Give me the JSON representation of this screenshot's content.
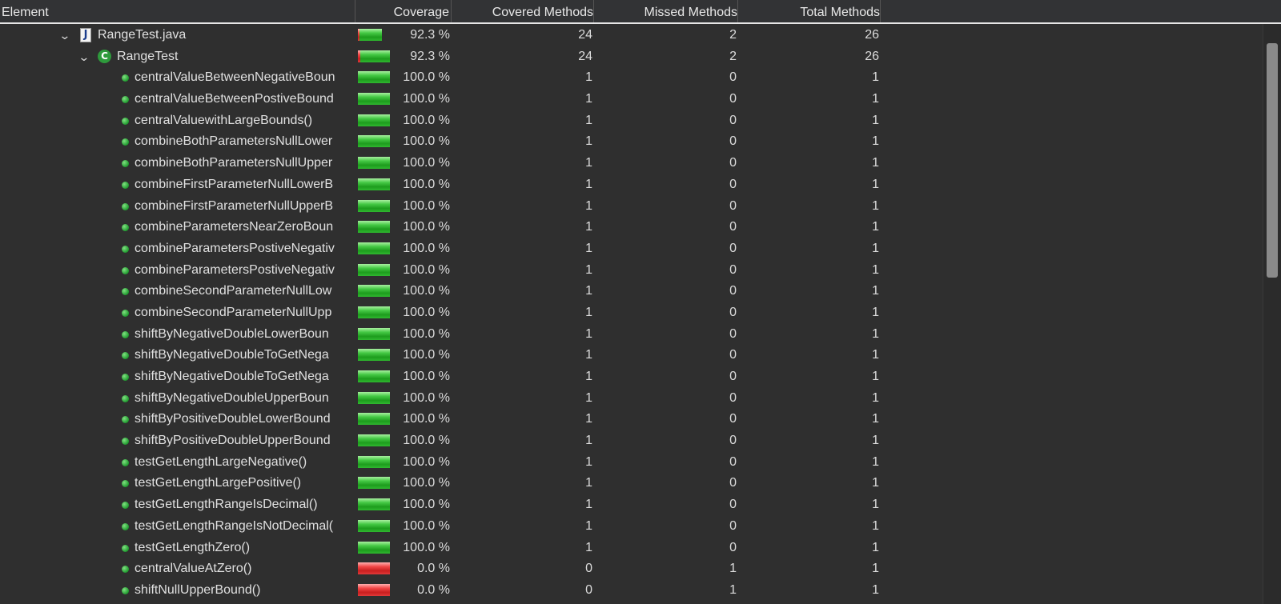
{
  "header": {
    "element": "Element",
    "coverage": "Coverage",
    "covered_methods": "Covered Methods",
    "missed_methods": "Missed Methods",
    "total_methods": "Total Methods"
  },
  "colors": {
    "background": "#2f2f2f",
    "covered": "#2fb82f",
    "missed": "#e03a3a",
    "text": "#e0e0e0"
  },
  "rows": [
    {
      "kind": "file",
      "name": "RangeTest.java",
      "icon": "java-file-icon",
      "coverage": "92.3 %",
      "ratio": 0.923,
      "covered": "24",
      "missed": "2",
      "total": "26"
    },
    {
      "kind": "class",
      "name": "RangeTest",
      "icon": "class-icon",
      "coverage": "92.3 %",
      "ratio": 0.923,
      "covered": "24",
      "missed": "2",
      "total": "26"
    },
    {
      "kind": "method",
      "name": "centralValueBetweenNegativeBoun",
      "icon": "method-icon",
      "coverage": "100.0 %",
      "ratio": 1.0,
      "covered": "1",
      "missed": "0",
      "total": "1"
    },
    {
      "kind": "method",
      "name": "centralValueBetweenPostiveBound",
      "icon": "method-icon",
      "coverage": "100.0 %",
      "ratio": 1.0,
      "covered": "1",
      "missed": "0",
      "total": "1"
    },
    {
      "kind": "method",
      "name": "centralValuewithLargeBounds()",
      "icon": "method-icon",
      "coverage": "100.0 %",
      "ratio": 1.0,
      "covered": "1",
      "missed": "0",
      "total": "1"
    },
    {
      "kind": "method",
      "name": "combineBothParametersNullLower",
      "icon": "method-icon",
      "coverage": "100.0 %",
      "ratio": 1.0,
      "covered": "1",
      "missed": "0",
      "total": "1"
    },
    {
      "kind": "method",
      "name": "combineBothParametersNullUpper",
      "icon": "method-icon",
      "coverage": "100.0 %",
      "ratio": 1.0,
      "covered": "1",
      "missed": "0",
      "total": "1"
    },
    {
      "kind": "method",
      "name": "combineFirstParameterNullLowerB",
      "icon": "method-icon",
      "coverage": "100.0 %",
      "ratio": 1.0,
      "covered": "1",
      "missed": "0",
      "total": "1"
    },
    {
      "kind": "method",
      "name": "combineFirstParameterNullUpperB",
      "icon": "method-icon",
      "coverage": "100.0 %",
      "ratio": 1.0,
      "covered": "1",
      "missed": "0",
      "total": "1"
    },
    {
      "kind": "method",
      "name": "combineParametersNearZeroBoun",
      "icon": "method-icon",
      "coverage": "100.0 %",
      "ratio": 1.0,
      "covered": "1",
      "missed": "0",
      "total": "1"
    },
    {
      "kind": "method",
      "name": "combineParametersPostiveNegativ",
      "icon": "method-icon",
      "coverage": "100.0 %",
      "ratio": 1.0,
      "covered": "1",
      "missed": "0",
      "total": "1"
    },
    {
      "kind": "method",
      "name": "combineParametersPostiveNegativ",
      "icon": "method-icon",
      "coverage": "100.0 %",
      "ratio": 1.0,
      "covered": "1",
      "missed": "0",
      "total": "1"
    },
    {
      "kind": "method",
      "name": "combineSecondParameterNullLow",
      "icon": "method-icon",
      "coverage": "100.0 %",
      "ratio": 1.0,
      "covered": "1",
      "missed": "0",
      "total": "1"
    },
    {
      "kind": "method",
      "name": "combineSecondParameterNullUpp",
      "icon": "method-icon",
      "coverage": "100.0 %",
      "ratio": 1.0,
      "covered": "1",
      "missed": "0",
      "total": "1"
    },
    {
      "kind": "method",
      "name": "shiftByNegativeDoubleLowerBoun",
      "icon": "method-icon",
      "coverage": "100.0 %",
      "ratio": 1.0,
      "covered": "1",
      "missed": "0",
      "total": "1"
    },
    {
      "kind": "method",
      "name": "shiftByNegativeDoubleToGetNega",
      "icon": "method-icon",
      "coverage": "100.0 %",
      "ratio": 1.0,
      "covered": "1",
      "missed": "0",
      "total": "1"
    },
    {
      "kind": "method",
      "name": "shiftByNegativeDoubleToGetNega",
      "icon": "method-icon",
      "coverage": "100.0 %",
      "ratio": 1.0,
      "covered": "1",
      "missed": "0",
      "total": "1"
    },
    {
      "kind": "method",
      "name": "shiftByNegativeDoubleUpperBoun",
      "icon": "method-icon",
      "coverage": "100.0 %",
      "ratio": 1.0,
      "covered": "1",
      "missed": "0",
      "total": "1"
    },
    {
      "kind": "method",
      "name": "shiftByPositiveDoubleLowerBound",
      "icon": "method-icon",
      "coverage": "100.0 %",
      "ratio": 1.0,
      "covered": "1",
      "missed": "0",
      "total": "1"
    },
    {
      "kind": "method",
      "name": "shiftByPositiveDoubleUpperBound",
      "icon": "method-icon",
      "coverage": "100.0 %",
      "ratio": 1.0,
      "covered": "1",
      "missed": "0",
      "total": "1"
    },
    {
      "kind": "method",
      "name": "testGetLengthLargeNegative()",
      "icon": "method-icon",
      "coverage": "100.0 %",
      "ratio": 1.0,
      "covered": "1",
      "missed": "0",
      "total": "1"
    },
    {
      "kind": "method",
      "name": "testGetLengthLargePositive()",
      "icon": "method-icon",
      "coverage": "100.0 %",
      "ratio": 1.0,
      "covered": "1",
      "missed": "0",
      "total": "1"
    },
    {
      "kind": "method",
      "name": "testGetLengthRangeIsDecimal()",
      "icon": "method-icon",
      "coverage": "100.0 %",
      "ratio": 1.0,
      "covered": "1",
      "missed": "0",
      "total": "1"
    },
    {
      "kind": "method",
      "name": "testGetLengthRangeIsNotDecimal(",
      "icon": "method-icon",
      "coverage": "100.0 %",
      "ratio": 1.0,
      "covered": "1",
      "missed": "0",
      "total": "1"
    },
    {
      "kind": "method",
      "name": "testGetLengthZero()",
      "icon": "method-icon",
      "coverage": "100.0 %",
      "ratio": 1.0,
      "covered": "1",
      "missed": "0",
      "total": "1"
    },
    {
      "kind": "method",
      "name": "centralValueAtZero()",
      "icon": "method-icon",
      "coverage": "0.0 %",
      "ratio": 0.0,
      "covered": "0",
      "missed": "1",
      "total": "1"
    },
    {
      "kind": "method",
      "name": "shiftNullUpperBound()",
      "icon": "method-icon",
      "coverage": "0.0 %",
      "ratio": 0.0,
      "covered": "0",
      "missed": "1",
      "total": "1"
    }
  ]
}
